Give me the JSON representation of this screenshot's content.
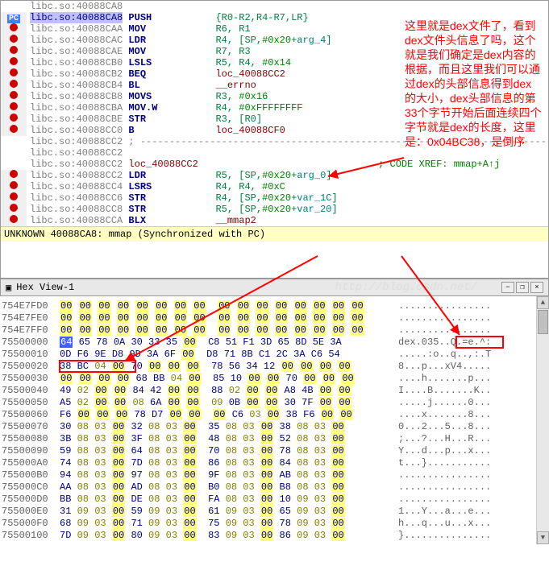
{
  "disasm": {
    "pc_label": "PC",
    "lines": [
      {
        "addr": "libc.so:40088CA8",
        "hl": false,
        "rest": ""
      },
      {
        "addr": "libc.so:40088CA8",
        "hl": true,
        "mnem": "PUSH",
        "ops": "{R0-R2,R4-R7,LR}"
      },
      {
        "addr": "libc.so:40088CAA",
        "mnem": "MOV",
        "ops": "R6, R1"
      },
      {
        "addr": "libc.so:40088CAC",
        "mnem": "LDR",
        "ops": "R4, [SP,#0x20+arg_4]"
      },
      {
        "addr": "libc.so:40088CAE",
        "mnem": "MOV",
        "ops": "R7, R3"
      },
      {
        "addr": "libc.so:40088CB0",
        "mnem": "LSLS",
        "ops": "R5, R4, #0x14"
      },
      {
        "addr": "libc.so:40088CB2",
        "mnem": "BEQ",
        "ops": "loc_40088CC2"
      },
      {
        "addr": "libc.so:40088CB4",
        "mnem": "BL",
        "ops": "__errno"
      },
      {
        "addr": "libc.so:40088CB8",
        "mnem": "MOVS",
        "ops": "R3, #0x16"
      },
      {
        "addr": "libc.so:40088CBA",
        "mnem": "MOV.W",
        "ops": "R4, #0xFFFFFFFF"
      },
      {
        "addr": "libc.so:40088CBE",
        "mnem": "STR",
        "ops": "R3, [R0]"
      },
      {
        "addr": "libc.so:40088CC0",
        "mnem": "B",
        "ops": "loc_40088CF0"
      },
      {
        "addr": "libc.so:40088CC2",
        "rest": "; ---------------------------------------------------------------------------"
      },
      {
        "addr": "libc.so:40088CC2",
        "rest": ""
      },
      {
        "addr": "libc.so:40088CC2",
        "loc": "loc_40088CC2",
        "xref": "; CODE XREF: mmap+A↑j"
      },
      {
        "addr": "libc.so:40088CC2",
        "mnem": "LDR",
        "ops": "R5, [SP,#0x20+arg_0]"
      },
      {
        "addr": "libc.so:40088CC4",
        "mnem": "LSRS",
        "ops": "R4, R4, #0xC"
      },
      {
        "addr": "libc.so:40088CC6",
        "mnem": "STR",
        "ops": "R4, [SP,#0x20+var_1C]"
      },
      {
        "addr": "libc.so:40088CC8",
        "mnem": "STR",
        "ops": "R5, [SP,#0x20+var_20]"
      },
      {
        "addr": "libc.so:40088CCA",
        "mnem": "BLX",
        "ops": "__mmap2"
      }
    ],
    "status": "UNKNOWN 40088CA8: mmap (Synchronized with PC)"
  },
  "annotation": "这里就是dex文件了，看到dex文件头信息了吗，这个就是我们确定是dex内容的根据，而且这里我们可以通过dex的头部信息得到dex的大小，dex头部信息的第33个字节开始后面连续四个字节就是dex的长度，这里是：0x04BC38，是倒序",
  "hexview": {
    "title": "Hex View-1",
    "min_icon": "−",
    "rest_icon": "❐",
    "close_icon": "×",
    "watermark": "http://blog.csdn.net/",
    "rows": [
      {
        "a": "754E7FD0",
        "b": [
          "00",
          "00",
          "00",
          "00",
          "00",
          "00",
          "00",
          "00",
          "00",
          "00",
          "00",
          "00",
          "00",
          "00",
          "00",
          "00"
        ],
        "asc": "................"
      },
      {
        "a": "754E7FE0",
        "b": [
          "00",
          "00",
          "00",
          "00",
          "00",
          "00",
          "00",
          "00",
          "00",
          "00",
          "00",
          "00",
          "00",
          "00",
          "00",
          "00"
        ],
        "asc": "................"
      },
      {
        "a": "754E7FF0",
        "b": [
          "00",
          "00",
          "00",
          "00",
          "00",
          "00",
          "00",
          "00",
          "00",
          "00",
          "00",
          "00",
          "00",
          "00",
          "00",
          "00"
        ],
        "asc": "................"
      },
      {
        "a": "75500000",
        "b": [
          "64",
          "65",
          "78",
          "0A",
          "30",
          "33",
          "35",
          "00",
          "C8",
          "51",
          "F1",
          "3D",
          "65",
          "8D",
          "5E",
          "3A"
        ],
        "asc": "dex.035..Q.=e.^:",
        "sel": 0
      },
      {
        "a": "75500010",
        "b": [
          "0D",
          "F6",
          "9E",
          "D8",
          "9D",
          "3A",
          "6F",
          "00",
          "D8",
          "71",
          "8B",
          "C1",
          "2C",
          "3A",
          "C6",
          "54"
        ],
        "asc": ".....:o..q..,:.T"
      },
      {
        "a": "75500020",
        "b": [
          "38",
          "BC",
          "04",
          "00",
          "70",
          "00",
          "00",
          "00",
          "78",
          "56",
          "34",
          "12",
          "00",
          "00",
          "00",
          "00"
        ],
        "asc": "8...p...xV4....."
      },
      {
        "a": "75500030",
        "b": [
          "00",
          "00",
          "00",
          "00",
          "68",
          "BB",
          "04",
          "00",
          "85",
          "10",
          "00",
          "00",
          "70",
          "00",
          "00",
          "00"
        ],
        "asc": "....h.......p..."
      },
      {
        "a": "75500040",
        "b": [
          "49",
          "02",
          "00",
          "00",
          "84",
          "42",
          "00",
          "00",
          "88",
          "02",
          "00",
          "00",
          "A8",
          "4B",
          "00",
          "00"
        ],
        "asc": "I....B.......K.."
      },
      {
        "a": "75500050",
        "b": [
          "A5",
          "02",
          "00",
          "00",
          "08",
          "6A",
          "00",
          "00",
          "09",
          "0B",
          "00",
          "00",
          "30",
          "7F",
          "00",
          "00"
        ],
        "asc": ".....j......0..."
      },
      {
        "a": "75500060",
        "b": [
          "F6",
          "00",
          "00",
          "00",
          "78",
          "D7",
          "00",
          "00",
          "00",
          "C6",
          "03",
          "00",
          "38",
          "F6",
          "00",
          "00"
        ],
        "asc": "....x.......8..."
      },
      {
        "a": "75500070",
        "b": [
          "30",
          "08",
          "03",
          "00",
          "32",
          "08",
          "03",
          "00",
          "35",
          "08",
          "03",
          "00",
          "38",
          "08",
          "03",
          "00"
        ],
        "asc": "0...2...5...8..."
      },
      {
        "a": "75500080",
        "b": [
          "3B",
          "08",
          "03",
          "00",
          "3F",
          "08",
          "03",
          "00",
          "48",
          "08",
          "03",
          "00",
          "52",
          "08",
          "03",
          "00"
        ],
        "asc": ";...?...H...R..."
      },
      {
        "a": "75500090",
        "b": [
          "59",
          "08",
          "03",
          "00",
          "64",
          "08",
          "03",
          "00",
          "70",
          "08",
          "03",
          "00",
          "78",
          "08",
          "03",
          "00"
        ],
        "asc": "Y...d...p...x..."
      },
      {
        "a": "755000A0",
        "b": [
          "74",
          "08",
          "03",
          "00",
          "7D",
          "08",
          "03",
          "00",
          "86",
          "08",
          "03",
          "00",
          "84",
          "08",
          "03",
          "00"
        ],
        "asc": "t...}..........."
      },
      {
        "a": "755000B0",
        "b": [
          "94",
          "08",
          "03",
          "00",
          "97",
          "08",
          "03",
          "00",
          "9F",
          "08",
          "03",
          "00",
          "AB",
          "08",
          "03",
          "00"
        ],
        "asc": "................"
      },
      {
        "a": "755000C0",
        "b": [
          "AA",
          "08",
          "03",
          "00",
          "AD",
          "08",
          "03",
          "00",
          "B0",
          "08",
          "03",
          "00",
          "B8",
          "08",
          "03",
          "00"
        ],
        "asc": "................"
      },
      {
        "a": "755000D0",
        "b": [
          "BB",
          "08",
          "03",
          "00",
          "DE",
          "08",
          "03",
          "00",
          "FA",
          "08",
          "03",
          "00",
          "10",
          "09",
          "03",
          "00"
        ],
        "asc": "................"
      },
      {
        "a": "755000E0",
        "b": [
          "31",
          "09",
          "03",
          "00",
          "59",
          "09",
          "03",
          "00",
          "61",
          "09",
          "03",
          "00",
          "65",
          "09",
          "03",
          "00"
        ],
        "asc": "1...Y...a...e..."
      },
      {
        "a": "755000F0",
        "b": [
          "68",
          "09",
          "03",
          "00",
          "71",
          "09",
          "03",
          "00",
          "75",
          "09",
          "03",
          "00",
          "78",
          "09",
          "03",
          "00"
        ],
        "asc": "h...q...u...x..."
      },
      {
        "a": "75500100",
        "b": [
          "7D",
          "09",
          "03",
          "00",
          "80",
          "09",
          "03",
          "00",
          "83",
          "09",
          "03",
          "00",
          "86",
          "09",
          "03",
          "00"
        ],
        "asc": "}..............."
      }
    ]
  }
}
